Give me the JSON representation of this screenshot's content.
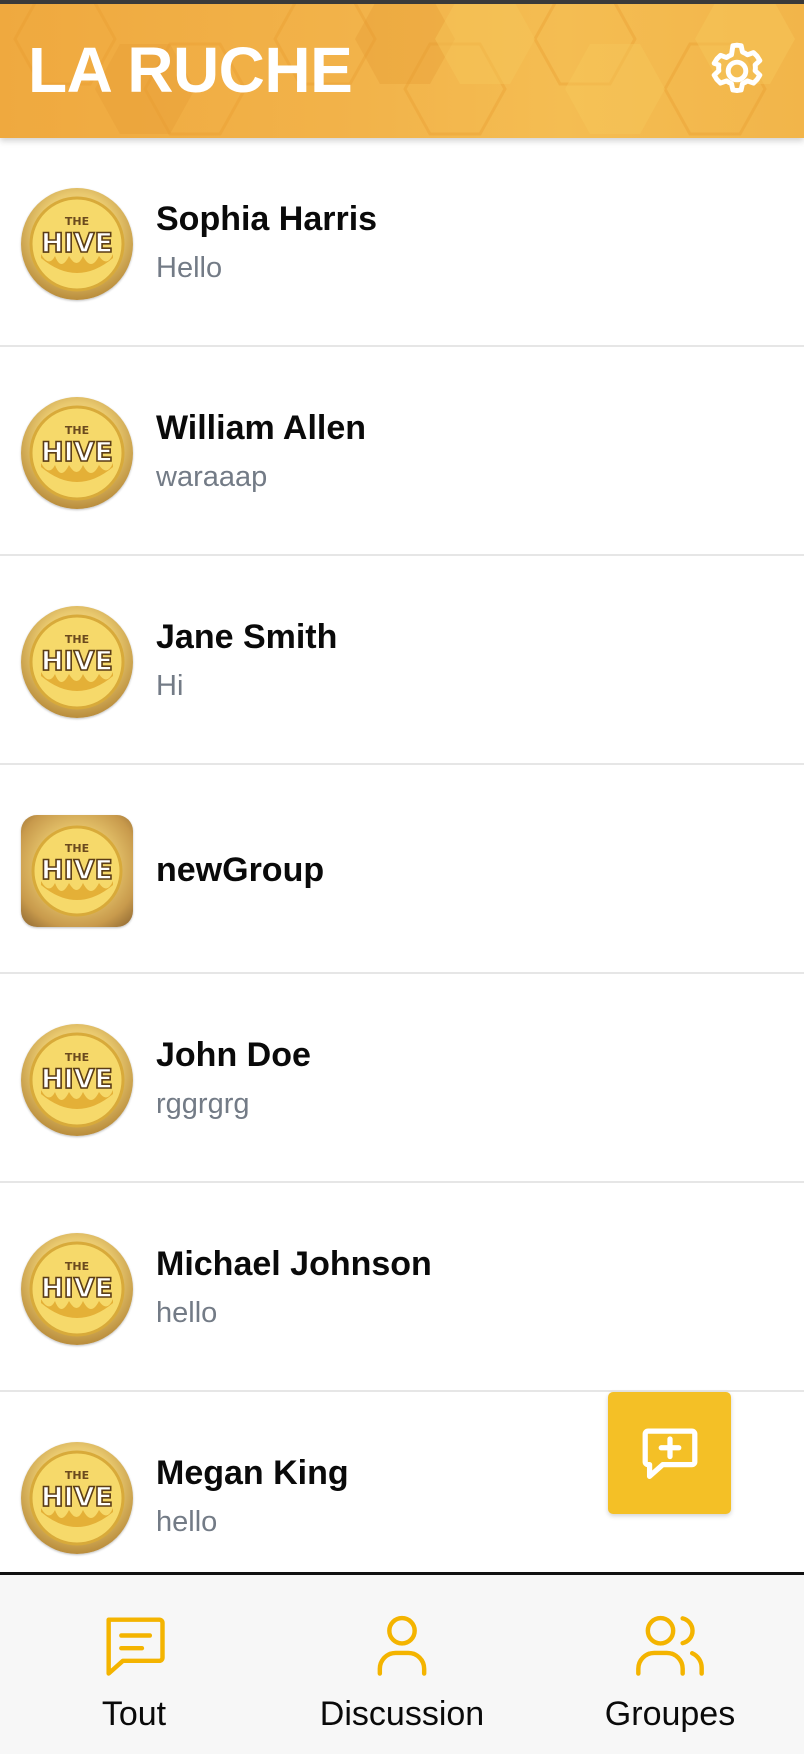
{
  "header": {
    "title": "LA RUCHE",
    "settings_icon": "gear-icon",
    "brand_color": "#f2b34a"
  },
  "avatar": {
    "line1": "THE",
    "line2": "HIVE"
  },
  "chats": [
    {
      "name": "Sophia Harris",
      "preview": "Hello",
      "avatar_shape": "circle"
    },
    {
      "name": "William Allen",
      "preview": "waraaap",
      "avatar_shape": "circle"
    },
    {
      "name": "Jane Smith",
      "preview": "Hi",
      "avatar_shape": "circle"
    },
    {
      "name": "newGroup",
      "preview": "",
      "avatar_shape": "square"
    },
    {
      "name": "John Doe",
      "preview": "rggrgrg",
      "avatar_shape": "circle"
    },
    {
      "name": "Michael Johnson",
      "preview": "hello",
      "avatar_shape": "circle"
    },
    {
      "name": "Megan King",
      "preview": "hello",
      "avatar_shape": "circle"
    }
  ],
  "fab": {
    "icon": "new-message-icon",
    "color": "#f4c026"
  },
  "nav": {
    "accent_color": "#f4b400",
    "tabs": [
      {
        "label": "Tout",
        "icon": "chat-bubble-icon"
      },
      {
        "label": "Discussion",
        "icon": "user-icon"
      },
      {
        "label": "Groupes",
        "icon": "users-icon"
      }
    ]
  }
}
